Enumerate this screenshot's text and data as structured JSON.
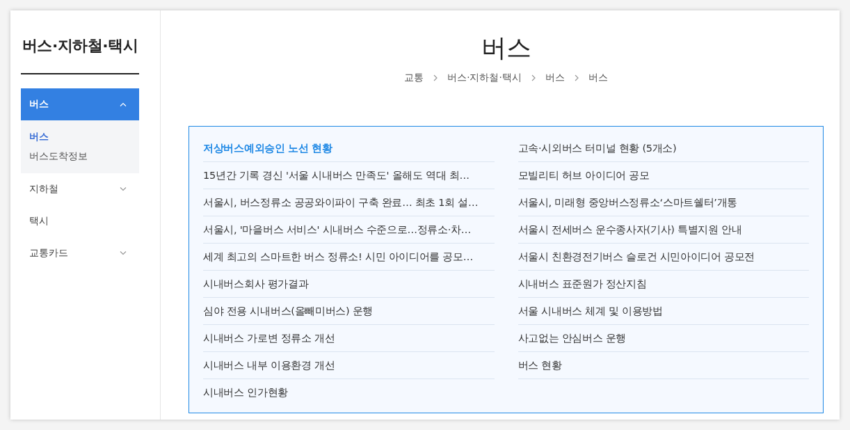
{
  "sidebar": {
    "title": "버스·지하철·택시",
    "items": [
      {
        "label": "버스",
        "kind": "group",
        "selected": true,
        "expanded": true,
        "children": [
          {
            "label": "버스",
            "selected": true
          },
          {
            "label": "버스도착정보",
            "selected": false
          }
        ]
      },
      {
        "label": "지하철",
        "kind": "group",
        "selected": false,
        "expanded": false
      },
      {
        "label": "택시",
        "kind": "link",
        "selected": false
      },
      {
        "label": "교통카드",
        "kind": "group",
        "selected": false,
        "expanded": false
      }
    ]
  },
  "page": {
    "title": "버스",
    "breadcrumb": [
      "교통",
      "버스·지하철·택시",
      "버스",
      "버스"
    ]
  },
  "links": [
    {
      "label": "저상버스예외승인 노선 현황",
      "selected": true
    },
    {
      "label": "고속·시외버스 터미널 현황 (5개소)",
      "selected": false
    },
    {
      "label": "15년간 기록 경신 '서울 시내버스 만족도' 올해도 역대 최…",
      "selected": false
    },
    {
      "label": "모빌리티 허브 아이디어 공모",
      "selected": false
    },
    {
      "label": "서울시, 버스정류소 공공와이파이 구축 완료… 최초 1회 설…",
      "selected": false
    },
    {
      "label": "서울시, 미래형 중앙버스정류소‘스마트쉘터’개통",
      "selected": false
    },
    {
      "label": "서울시, '마을버스 서비스' 시내버스 수준으로…정류소·차…",
      "selected": false
    },
    {
      "label": "서울시 전세버스 운수종사자(기사) 특별지원 안내",
      "selected": false
    },
    {
      "label": "세계 최고의 스마트한 버스 정류소! 시민 아이디어를 공모…",
      "selected": false
    },
    {
      "label": "서울시 친환경전기버스 슬로건 시민아이디어 공모전",
      "selected": false
    },
    {
      "label": "시내버스회사 평가결과",
      "selected": false
    },
    {
      "label": "시내버스 표준원가 정산지침",
      "selected": false
    },
    {
      "label": "심야 전용 시내버스(올빼미버스) 운행",
      "selected": false
    },
    {
      "label": "서울 시내버스 체계 및 이용방법",
      "selected": false
    },
    {
      "label": "시내버스 가로변 정류소 개선",
      "selected": false
    },
    {
      "label": "사고없는 안심버스 운행",
      "selected": false
    },
    {
      "label": "시내버스 내부 이용환경 개선",
      "selected": false
    },
    {
      "label": "버스 현황",
      "selected": false
    },
    {
      "label": "시내버스 인가현황",
      "selected": false
    }
  ]
}
